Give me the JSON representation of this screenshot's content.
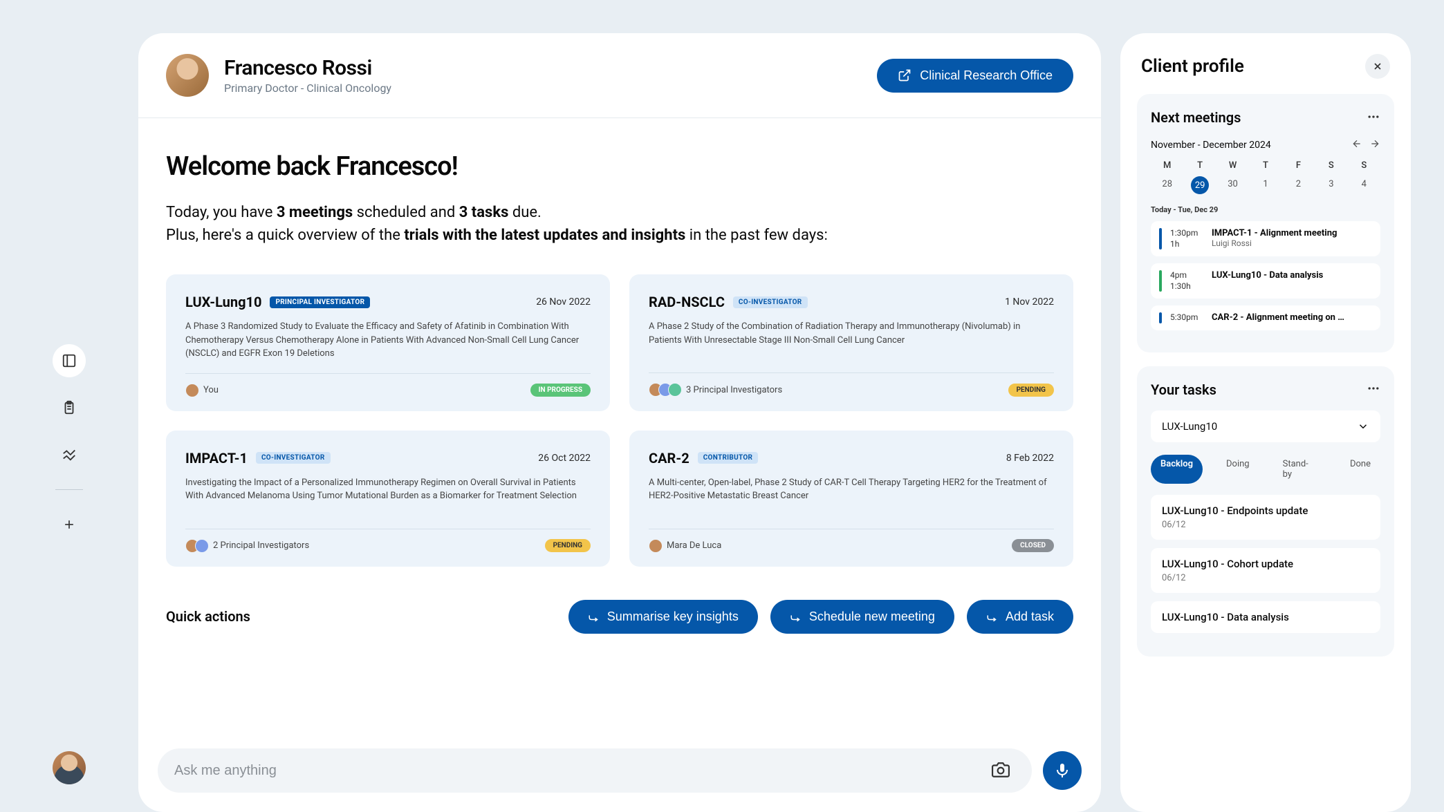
{
  "colors": {
    "primary": "#0557a9",
    "bg": "#e8eef3",
    "card_bg": "#ecf3fa"
  },
  "user": {
    "name": "Francesco Rossi",
    "role": "Primary Doctor - Clinical Oncology"
  },
  "header": {
    "button_label": "Clinical Research Office"
  },
  "welcome": {
    "heading": "Welcome back Francesco!",
    "line1_pre": "Today, you have ",
    "line1_meetings": "3 meetings",
    "line1_mid": " scheduled and ",
    "line1_tasks": "3 tasks",
    "line1_post": " due.",
    "line2_pre": "Plus, here's a quick overview of the ",
    "line2_bold": "trials with the latest updates and insights",
    "line2_post": " in the past few days:"
  },
  "trials": [
    {
      "name": "LUX-Lung10",
      "role": "PRINCIPAL INVESTIGATOR",
      "role_class": "role-principal",
      "date": "26 Nov 2022",
      "desc": "A Phase 3 Randomized Study to Evaluate the Efficacy and Safety of Afatinib in Combination With Chemotherapy Versus Chemotherapy Alone in Patients With Advanced Non-Small Cell Lung Cancer (NSCLC) and EGFR Exon 19 Deletions",
      "pi": "You",
      "avatars": 1,
      "status": "IN PROGRESS",
      "status_class": "st-progress"
    },
    {
      "name": "RAD-NSCLC",
      "role": "CO-INVESTIGATOR",
      "role_class": "role-co",
      "date": "1 Nov 2022",
      "desc": "A Phase 2 Study of the Combination of Radiation Therapy and Immunotherapy (Nivolumab) in Patients With Unresectable Stage III Non-Small Cell Lung Cancer",
      "pi": "3 Principal Investigators",
      "avatars": 3,
      "status": "PENDING",
      "status_class": "st-pending"
    },
    {
      "name": "IMPACT-1",
      "role": "CO-INVESTIGATOR",
      "role_class": "role-co",
      "date": "26 Oct 2022",
      "desc": "Investigating the Impact of a Personalized Immunotherapy Regimen on Overall Survival in Patients With Advanced Melanoma Using Tumor Mutational Burden as a Biomarker for Treatment Selection",
      "pi": "2 Principal Investigators",
      "avatars": 2,
      "status": "PENDING",
      "status_class": "st-pending"
    },
    {
      "name": "CAR-2",
      "role": "CONTRIBUTOR",
      "role_class": "role-contrib",
      "date": "8 Feb 2022",
      "desc": "A Multi-center, Open-label, Phase 2 Study of CAR-T Cell Therapy Targeting HER2 for the Treatment of HER2-Positive Metastatic Breast Cancer",
      "pi": "Mara De Luca",
      "avatars": 1,
      "status": "CLOSED",
      "status_class": "st-closed"
    }
  ],
  "quick_actions": {
    "title": "Quick actions",
    "buttons": [
      "Summarise key insights",
      "Schedule new meeting",
      "Add task"
    ]
  },
  "chat": {
    "placeholder": "Ask me anything"
  },
  "right_panel": {
    "title": "Client profile",
    "meetings_card": {
      "title": "Next meetings",
      "range": "November - December 2024",
      "dow": [
        "M",
        "T",
        "W",
        "T",
        "F",
        "S",
        "S"
      ],
      "days": [
        "28",
        "29",
        "30",
        "1",
        "2",
        "3",
        "4"
      ],
      "selected_index": 1,
      "today_label": "Today - Tue, Dec 29",
      "meetings": [
        {
          "time1": "1:30pm",
          "time2": "1h",
          "title": "IMPACT-1 - Alignment meeting",
          "sub": "Luigi Rossi",
          "bar": "mb1"
        },
        {
          "time1": "4pm",
          "time2": "1:30h",
          "title": "LUX-Lung10 - Data analysis",
          "sub": "",
          "bar": "mb2"
        },
        {
          "time1": "5:30pm",
          "time2": "",
          "title": "CAR-2 - Alignment meeting on …",
          "sub": "",
          "bar": "mb3"
        }
      ]
    },
    "tasks_card": {
      "title": "Your tasks",
      "selected_trial": "LUX-Lung10",
      "tabs": [
        "Backlog",
        "Doing",
        "Stand-by",
        "Done"
      ],
      "active_tab": 0,
      "items": [
        {
          "title": "LUX-Lung10 - Endpoints update",
          "date": "06/12"
        },
        {
          "title": "LUX-Lung10 - Cohort update",
          "date": "06/12"
        },
        {
          "title": "LUX-Lung10 - Data analysis",
          "date": ""
        }
      ]
    }
  }
}
